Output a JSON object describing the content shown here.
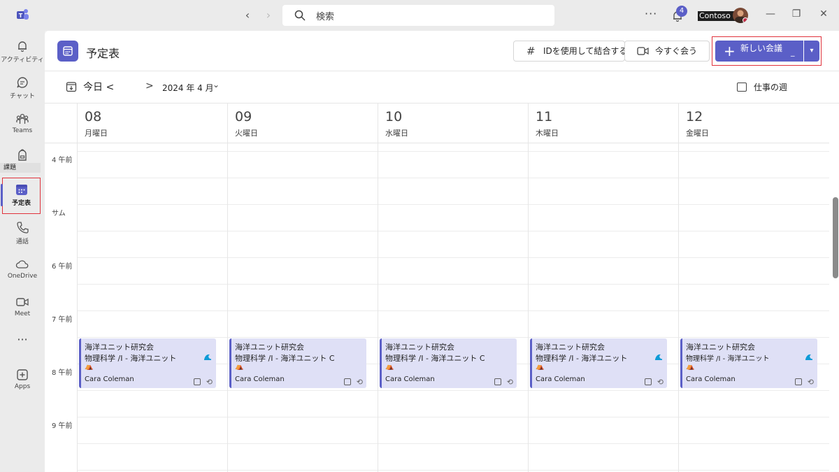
{
  "titlebar": {
    "search_placeholder": "検索",
    "more_label": "···",
    "notification_count": "4",
    "org_name": "Contoso s",
    "minimize_label": "—",
    "maximize_label": "❐",
    "close_label": "✕"
  },
  "rail": {
    "items": [
      {
        "label": "アクティビティ",
        "icon": "bell-icon"
      },
      {
        "label": "チャット",
        "icon": "chat-icon"
      },
      {
        "label": "Teams",
        "icon": "teams-icon"
      },
      {
        "label": "課題",
        "icon": "backpack-icon"
      },
      {
        "label": "予定表",
        "icon": "calendar-icon",
        "active": true
      },
      {
        "label": "通話",
        "icon": "phone-icon"
      },
      {
        "label": "OneDrive",
        "icon": "cloud-icon"
      },
      {
        "label": "Meet",
        "icon": "video-icon"
      },
      {
        "label": "···",
        "icon": "more-icon"
      },
      {
        "label": "Apps",
        "icon": "apps-icon"
      }
    ]
  },
  "header": {
    "title": "予定表",
    "join_with_id": "IDを使用して結合する",
    "meet_now": "今すぐ会う",
    "new_meeting": "新しい会議",
    "new_meeting_suffix": "_"
  },
  "nav": {
    "today": "今日 <",
    "next": ">",
    "month": "2024 年 4 月",
    "view": "仕事の週"
  },
  "days": [
    {
      "num": "08",
      "name": "月曜日"
    },
    {
      "num": "09",
      "name": "火曜日"
    },
    {
      "num": "10",
      "name": "水曜日"
    },
    {
      "num": "11",
      "name": "木曜日"
    },
    {
      "num": "12",
      "name": "金曜日"
    }
  ],
  "times": [
    "4 午前",
    "サム",
    "6 午前",
    "7 午前",
    "8 午前",
    "9 午前"
  ],
  "events": [
    {
      "title": "海洋ユニット研究会",
      "subtitle": "物理科学 /I - 海洋ユニット",
      "organizer": "Cara Coleman"
    },
    {
      "title": "海洋ユニット研究会",
      "subtitle": "物理科学 /I - 海洋ユニット C",
      "organizer": "Cara Coleman"
    },
    {
      "title": "海洋ユニット研究会",
      "subtitle": "物理科学 /I - 海洋ユニット C",
      "organizer": "Cara Coleman"
    },
    {
      "title": "海洋ユニット研究会",
      "subtitle": "物理科学 /I - 海洋ユニット",
      "organizer": "Cara Coleman"
    },
    {
      "title": "海洋ユニット研究会",
      "subtitle": "物理科学 /I - 海洋ユニット",
      "organizer": "Cara Coleman"
    }
  ],
  "colors": {
    "accent": "#5b5fc7",
    "event_bg": "#dfe0f6",
    "highlight": "#e0323c"
  }
}
